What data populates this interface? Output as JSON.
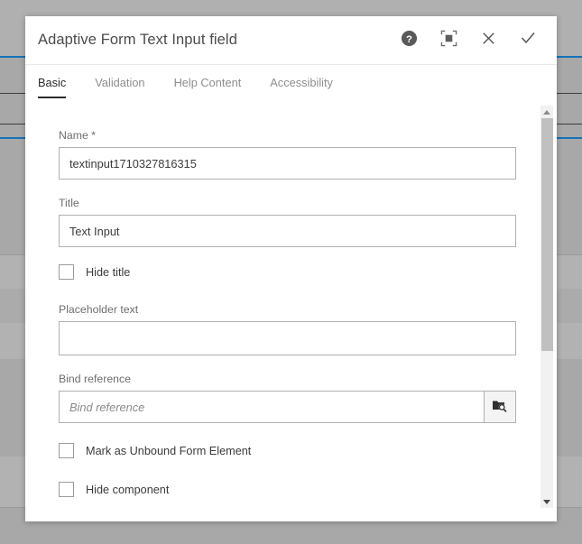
{
  "dialog": {
    "title": "Adaptive Form Text Input field",
    "actions": [
      {
        "name": "help-icon",
        "label": "Help"
      },
      {
        "name": "fullscreen-icon",
        "label": "Fullscreen"
      },
      {
        "name": "close-icon",
        "label": "Close"
      },
      {
        "name": "confirm-check-icon",
        "label": "Done"
      }
    ],
    "tabs": [
      {
        "label": "Basic",
        "active": true
      },
      {
        "label": "Validation",
        "active": false
      },
      {
        "label": "Help Content",
        "active": false
      },
      {
        "label": "Accessibility",
        "active": false
      }
    ],
    "fields": {
      "name": {
        "label": "Name *",
        "value": "textinput1710327816315",
        "placeholder": ""
      },
      "title": {
        "label": "Title",
        "value": "Text Input",
        "placeholder": ""
      },
      "hide_title": {
        "label": "Hide title",
        "checked": false
      },
      "placeholder_text": {
        "label": "Placeholder text",
        "value": "",
        "placeholder": ""
      },
      "bind_reference": {
        "label": "Bind reference",
        "value": "",
        "placeholder": "Bind reference",
        "picker_icon": "folder-search-icon"
      },
      "mark_unbound": {
        "label": "Mark as Unbound Form Element",
        "checked": false
      },
      "hide_component": {
        "label": "Hide component",
        "checked": false
      }
    },
    "scrollbar": {
      "up_arrow": "scroll-up-arrow",
      "down_arrow": "scroll-down-arrow"
    }
  },
  "colors": {
    "backdrop": "#a8a8a8",
    "accent_blue": "#1473b9",
    "tab_active": "#2b2b2b",
    "border": "#b1b1b1"
  }
}
